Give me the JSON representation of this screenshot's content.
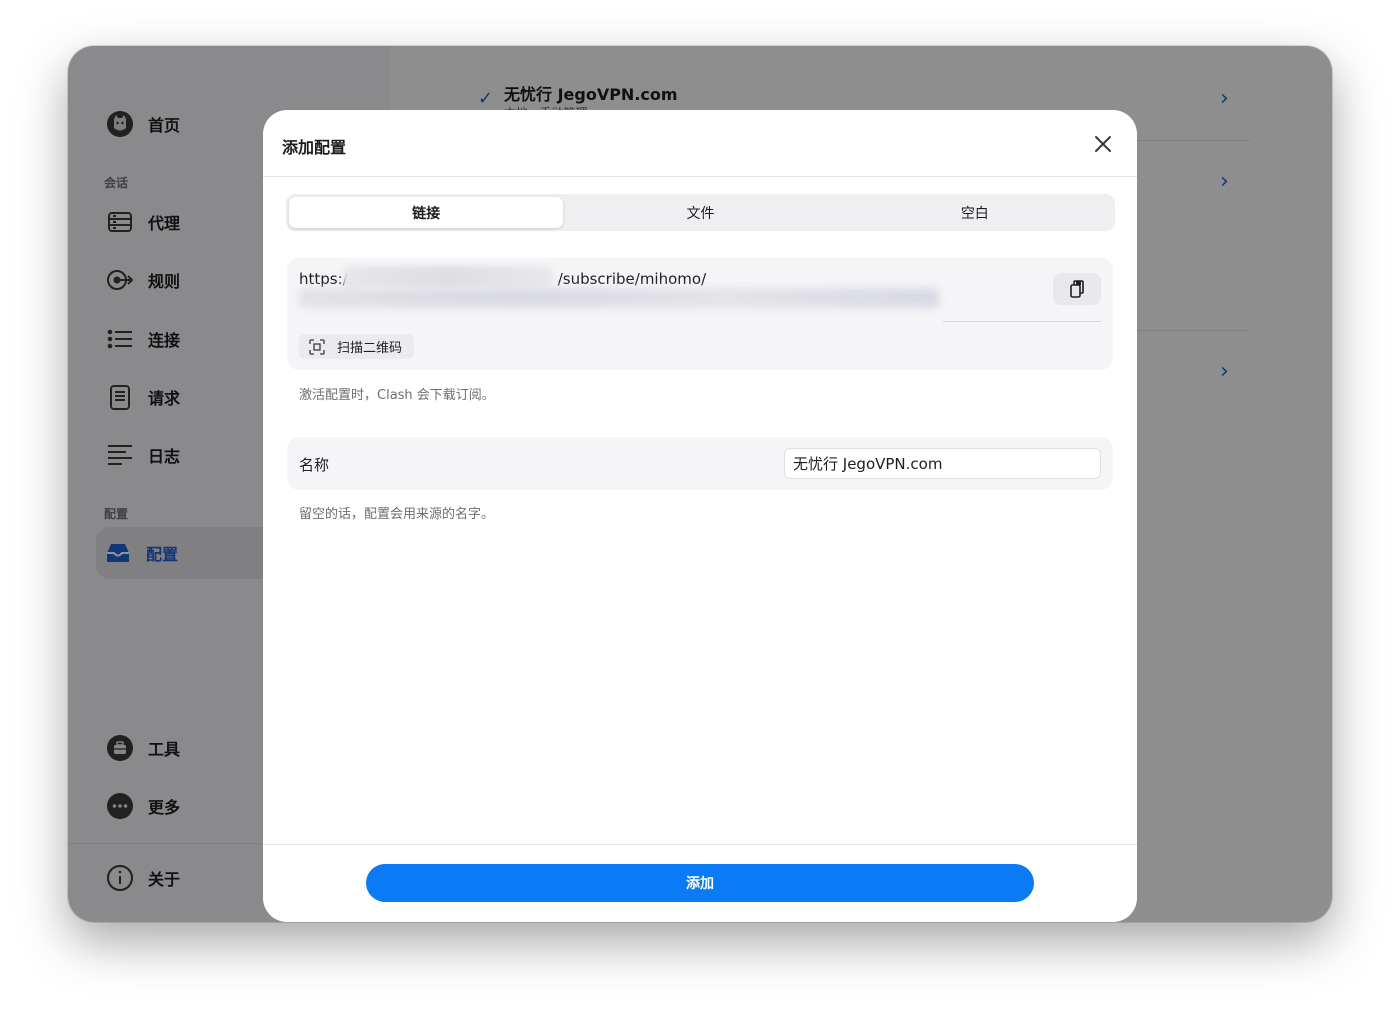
{
  "sidebar": {
    "items": [
      {
        "label": "首页",
        "icon": "cat-icon"
      },
      {
        "label": "代理",
        "icon": "server-icon"
      },
      {
        "label": "规则",
        "icon": "rules-icon"
      },
      {
        "label": "连接",
        "icon": "list-icon"
      },
      {
        "label": "请求",
        "icon": "document-icon"
      },
      {
        "label": "日志",
        "icon": "log-icon"
      },
      {
        "label": "配置",
        "icon": "inbox-icon",
        "active": true
      },
      {
        "label": "工具",
        "icon": "toolbox-icon"
      },
      {
        "label": "更多",
        "icon": "more-icon"
      },
      {
        "label": "关于",
        "icon": "info-icon"
      }
    ],
    "section_session": "会话",
    "section_config": "配置"
  },
  "background": {
    "profile_title": "无忧行 JegoVPN.com",
    "profile_sub": "本地 · 手动管理"
  },
  "modal": {
    "title": "添加配置",
    "tabs": [
      "链接",
      "文件",
      "空白"
    ],
    "url_prefix": "https:/",
    "url_suffix": "/subscribe/mihomo/",
    "scan_label": "扫描二维码",
    "url_hint": "激活配置时，Clash 会下载订阅。",
    "name_label": "名称",
    "name_value": "无忧行 JegoVPN.com",
    "name_hint": "留空的话，配置会用来源的名字。",
    "add_label": "添加"
  },
  "colors": {
    "accent": "#0a7bf5",
    "active_sidebar": "#1f5fd1"
  }
}
